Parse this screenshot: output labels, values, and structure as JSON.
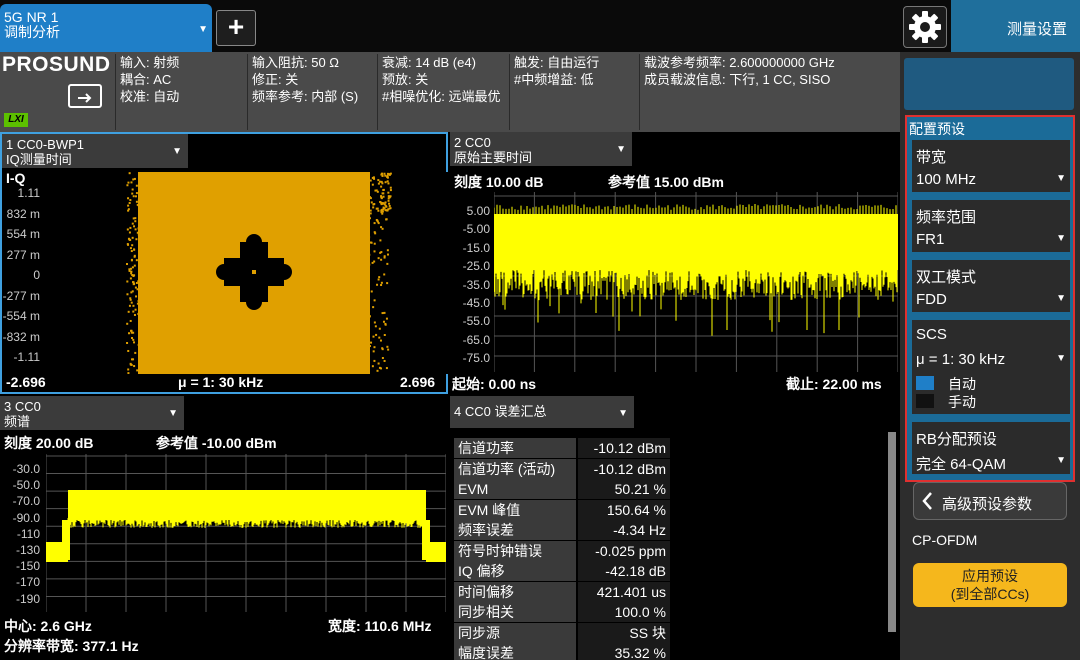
{
  "mode_tab": {
    "line1": "5G NR 1",
    "line2": "调制分析"
  },
  "meas_settings_title": "测量设置",
  "brand": "PROSUND",
  "lxi_badge": "LXI",
  "info": {
    "col1": [
      "输入: 射频",
      "耦合: AC",
      "校准: 自动"
    ],
    "col2": [
      "输入阻抗: 50 Ω",
      "修正: 关",
      "频率参考: 内部 (S)"
    ],
    "col3": [
      "衰减: 14 dB (e4)",
      "预放: 关",
      "#相噪优化: 远端最优"
    ],
    "col4": [
      "触发: 自由运行",
      "#中频增益: 低"
    ],
    "col5": [
      "载波参考频率: 2.600000000 GHz",
      "成员载波信息: 下行, 1 CC, SISO"
    ]
  },
  "win1": {
    "title1": "1 CC0-BWP1",
    "title2": "IQ测量时间",
    "trace_label": "I-Q",
    "yticks": [
      "1.11",
      "832 m",
      "554 m",
      "277 m",
      "0",
      "-277 m",
      "-554 m",
      "-832 m",
      "-1.11"
    ],
    "x_left": "-2.696",
    "x_center": "μ = 1: 30 kHz",
    "x_right": "2.696"
  },
  "win2": {
    "title1": "2 CC0",
    "title2": "原始主要时间",
    "scale": "刻度 10.00 dB",
    "ref": "参考值 15.00 dBm",
    "yticks": [
      "5.00",
      "-5.00",
      "-15.0",
      "-25.0",
      "-35.0",
      "-45.0",
      "-55.0",
      "-65.0",
      "-75.0"
    ],
    "start": "起始: 0.00 ns",
    "stop": "截止: 22.00 ms"
  },
  "win3": {
    "title1": "3 CC0",
    "title2": "频谱",
    "scale": "刻度 20.00 dB",
    "ref": "参考值 -10.00 dBm",
    "yticks": [
      "-30.0",
      "-50.0",
      "-70.0",
      "-90.0",
      "-110",
      "-130",
      "-150",
      "-170",
      "-190"
    ],
    "center": "中心: 2.6 GHz",
    "span": "宽度: 110.6 MHz",
    "rbw": "分辨率带宽: 377.1 Hz"
  },
  "win4": {
    "title": "4 CC0 误差汇总",
    "rows": [
      {
        "k": "信道功率",
        "v": "-10.12 dBm"
      },
      {
        "k": "信道功率 (活动)",
        "v": "-10.12 dBm"
      },
      {
        "k": "EVM",
        "v": "50.21 %"
      },
      {
        "k": "EVM 峰值",
        "v": "150.64 %"
      },
      {
        "k": "频率误差",
        "v": "-4.34 Hz"
      },
      {
        "k": "符号时钟错误",
        "v": "-0.025 ppm"
      },
      {
        "k": "IQ 偏移",
        "v": "-42.18 dB"
      },
      {
        "k": "时间偏移",
        "v": "421.401 us"
      },
      {
        "k": "同步相关",
        "v": "100.0 %"
      },
      {
        "k": "同步源",
        "v": "SS 块"
      },
      {
        "k": "幅度误差",
        "v": "35.32 %"
      }
    ]
  },
  "panel": {
    "group_title": "配置预设",
    "bandwidth": {
      "label": "带宽",
      "value": "100 MHz"
    },
    "freq_range": {
      "label": "频率范围",
      "value": "FR1"
    },
    "duplex": {
      "label": "双工模式",
      "value": "FDD"
    },
    "scs": {
      "label": "SCS",
      "value": "μ = 1: 30 kHz"
    },
    "auto": "自动",
    "manual": "手动",
    "rb_preset": {
      "label": "RB分配预设",
      "value": "完全 64-QAM"
    },
    "advanced": "高级预设参数",
    "cp_ofdm": "CP-OFDM",
    "apply_line1": "应用预设",
    "apply_line2": "(到全部CCs)"
  },
  "colors": {
    "trace_yellow": "#ffff00",
    "iq_orange": "#e0a000",
    "accent_blue": "#1f7fc8",
    "highlight_red": "#e03030",
    "apply_gold": "#f5b71c"
  }
}
